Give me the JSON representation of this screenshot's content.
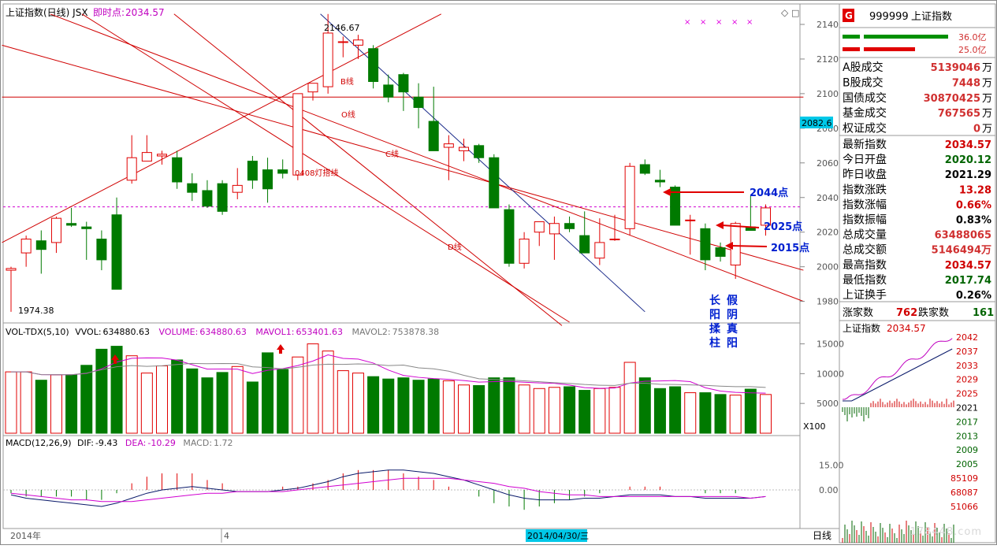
{
  "header": {
    "title": "上证指数(日线) JSX",
    "instant_label": "即时点:",
    "instant_value": "2034.57"
  },
  "main_chart": {
    "max_label": "2146.67",
    "min_label": "1974.38",
    "current_price_tag": "2082.6",
    "price_axis": [
      "2140",
      "2120",
      "2100",
      "2080",
      "2060",
      "2040",
      "2020",
      "2000",
      "1980"
    ],
    "line_labels": {
      "b": "B线",
      "o": "O线",
      "c": "C线",
      "d": "D线",
      "lamp": "0408灯搭线"
    },
    "annotations": {
      "p2044": "2044点",
      "p2025": "2025点",
      "p2015": "2015点",
      "note_left": [
        "长",
        "阳",
        "揉",
        "柱"
      ],
      "note_right": [
        "假",
        "阴",
        "真",
        "阳"
      ]
    }
  },
  "chart_data": {
    "type": "candlestick",
    "series_name": "上证指数",
    "ohlc": [
      [
        1998,
        2000,
        1974,
        1999
      ],
      [
        2008,
        2018,
        2000,
        2016
      ],
      [
        2015,
        2021,
        1996,
        2010
      ],
      [
        2014,
        2029,
        2008,
        2028
      ],
      [
        2025,
        2034,
        2023,
        2024
      ],
      [
        2023,
        2026,
        2004,
        2022
      ],
      [
        2016,
        2021,
        1998,
        2004
      ],
      [
        2030,
        2040,
        1987,
        1987
      ],
      [
        2050,
        2076,
        2048,
        2063
      ],
      [
        2061,
        2076,
        2063,
        2066
      ],
      [
        2064,
        2067,
        2059,
        2065
      ],
      [
        2063,
        2067,
        2045,
        2049
      ],
      [
        2048,
        2054,
        2038,
        2043
      ],
      [
        2044,
        2050,
        2034,
        2035
      ],
      [
        2048,
        2050,
        2030,
        2032
      ],
      [
        2043,
        2057,
        2039,
        2047
      ],
      [
        2061,
        2064,
        2045,
        2050
      ],
      [
        2056,
        2063,
        2037,
        2045
      ],
      [
        2056,
        2062,
        2051,
        2054
      ],
      [
        2053,
        2100,
        2050,
        2100
      ],
      [
        2101,
        2103,
        2096,
        2106
      ],
      [
        2104,
        2146,
        2100,
        2135
      ],
      [
        2130,
        2133,
        2121,
        2130
      ],
      [
        2128,
        2134,
        2120,
        2131
      ],
      [
        2126,
        2128,
        2103,
        2107
      ],
      [
        2105,
        2111,
        2095,
        2098
      ],
      [
        2111,
        2112,
        2090,
        2101
      ],
      [
        2098,
        2106,
        2080,
        2092
      ],
      [
        2084,
        2104,
        2067,
        2067
      ],
      [
        2069,
        2076,
        2050,
        2071
      ],
      [
        2067,
        2074,
        2061,
        2069
      ],
      [
        2070,
        2071,
        2060,
        2063
      ],
      [
        2063,
        2065,
        2035,
        2034
      ],
      [
        2033,
        2036,
        2000,
        2002
      ],
      [
        2002,
        2020,
        1999,
        2016
      ],
      [
        2020,
        2026,
        2012,
        2026
      ],
      [
        2019,
        2029,
        2004,
        2025
      ],
      [
        2025,
        2029,
        2020,
        2022
      ],
      [
        2018,
        2032,
        2008,
        2008
      ],
      [
        2005,
        2028,
        2001,
        2014
      ],
      [
        2016,
        2030,
        2015,
        2016
      ],
      [
        2022,
        2060,
        2018,
        2058
      ],
      [
        2059,
        2062,
        2053,
        2054
      ],
      [
        2050,
        2056,
        2046,
        2049
      ],
      [
        2046,
        2047,
        2024,
        2024
      ],
      [
        2027,
        2030,
        2007,
        2027
      ],
      [
        2022,
        2025,
        1998,
        2004
      ],
      [
        2011,
        2014,
        2003,
        2006
      ],
      [
        2001,
        2026,
        1993,
        2025
      ],
      [
        2023,
        2041,
        2021,
        2021
      ],
      [
        2024,
        2036,
        2018,
        2034
      ]
    ],
    "y_range": [
      1968,
      2150
    ],
    "volume": {
      "label": "VOL-TDX(5,10)",
      "vvol": "634880.63",
      "volume": "634880.63",
      "mavol1": "653401.63",
      "mavol2": "753878.38",
      "multiplier": "X100",
      "axis": [
        "15000",
        "10000",
        "5000"
      ],
      "values": [
        10300,
        10300,
        8900,
        9800,
        9800,
        11400,
        14100,
        14600,
        13000,
        10100,
        11300,
        12300,
        10800,
        9300,
        10200,
        11200,
        8600,
        13500,
        10700,
        12800,
        15000,
        13800,
        10500,
        10100,
        9500,
        9100,
        9300,
        8900,
        9100,
        8800,
        8100,
        8000,
        9300,
        9300,
        8100,
        7500,
        7700,
        7800,
        7200,
        7500,
        7700,
        11900,
        9300,
        7500,
        7800,
        6800,
        6800,
        6500,
        6400,
        7400,
        6500
      ]
    },
    "macd": {
      "label": "MACD(12,26,9)",
      "dif": "-9.43",
      "dea": "-10.29",
      "macd": "1.72",
      "axis": [
        "15.00",
        "0.00"
      ],
      "dif_values": [
        -3,
        -5,
        -6,
        -7,
        -8,
        -9,
        -10,
        -8,
        -5,
        -2,
        0,
        1,
        2,
        1,
        0,
        -1,
        -1,
        -1,
        0,
        1,
        3,
        5,
        8,
        10,
        11,
        12,
        12,
        11,
        10,
        8,
        6,
        3,
        0,
        -3,
        -5,
        -6,
        -6,
        -6,
        -5,
        -5,
        -4,
        -3,
        -3,
        -3,
        -4,
        -4,
        -5,
        -5,
        -5,
        -5,
        -4
      ],
      "dea_values": [
        -2,
        -3,
        -4,
        -5,
        -6,
        -6,
        -7,
        -7,
        -7,
        -6,
        -5,
        -4,
        -3,
        -2,
        -2,
        -1,
        -1,
        -1,
        -1,
        0,
        1,
        2,
        3,
        4,
        5,
        6,
        7,
        7,
        7,
        7,
        6,
        5,
        4,
        2,
        1,
        -1,
        -2,
        -3,
        -3,
        -4,
        -4,
        -4,
        -4,
        -4,
        -4,
        -4,
        -4,
        -4,
        -4,
        -5,
        -4
      ]
    }
  },
  "footer": {
    "year": "2014年",
    "month": "4",
    "cursor_date": "2014/04/30/三",
    "period": "日线"
  },
  "side_panel": {
    "code_badge": "G",
    "code": "999999",
    "name": "上证指数",
    "bar1_value": "36.0亿",
    "bar2_value": "25.0亿",
    "stats": [
      {
        "label": "A股成交",
        "value": "5139046",
        "unit": "万",
        "color": "#d03030"
      },
      {
        "label": "B股成交",
        "value": "7448",
        "unit": "万",
        "color": "#d03030"
      },
      {
        "label": "国债成交",
        "value": "30870425",
        "unit": "万",
        "color": "#d03030"
      },
      {
        "label": "基金成交",
        "value": "767565",
        "unit": "万",
        "color": "#d03030"
      },
      {
        "label": "权证成交",
        "value": "0",
        "unit": "万",
        "color": "#d03030"
      }
    ],
    "quotes": [
      {
        "label": "最新指数",
        "value": "2034.57",
        "color": "#d00000"
      },
      {
        "label": "今日开盘",
        "value": "2020.12",
        "color": "#006400"
      },
      {
        "label": "昨日收盘",
        "value": "2021.29",
        "color": "#000000"
      },
      {
        "label": "指数涨跌",
        "value": "13.28",
        "color": "#d00000"
      },
      {
        "label": "指数涨幅",
        "value": "0.66%",
        "color": "#d00000"
      },
      {
        "label": "指数振幅",
        "value": "0.83%",
        "color": "#000000"
      },
      {
        "label": "总成交量",
        "value": "63488065",
        "color": "#d03030"
      },
      {
        "label": "总成交额",
        "value": "5146494万",
        "color": "#d03030"
      },
      {
        "label": "最高指数",
        "value": "2034.57",
        "color": "#d00000"
      },
      {
        "label": "最低指数",
        "value": "2017.74",
        "color": "#006400"
      },
      {
        "label": "上证换手",
        "value": "0.26%",
        "color": "#000000"
      }
    ],
    "breadth": {
      "up_label": "涨家数",
      "up": "762",
      "down_label": "跌家数",
      "down": "161"
    },
    "mini_title": "上证指数",
    "mini_value": "2034.57",
    "mini_axis": [
      "2042",
      "2037",
      "2033",
      "2029",
      "2025",
      "2021",
      "2017",
      "2013",
      "2009",
      "2005",
      "85109",
      "68087",
      "51066"
    ]
  },
  "colors": {
    "up": "#e00000",
    "down": "#007a00",
    "axis": "#888888",
    "line_red": "#d00000",
    "line_blue": "#1a2a8a",
    "accent_magenta": "#d000d0"
  },
  "watermark": "178448.com"
}
